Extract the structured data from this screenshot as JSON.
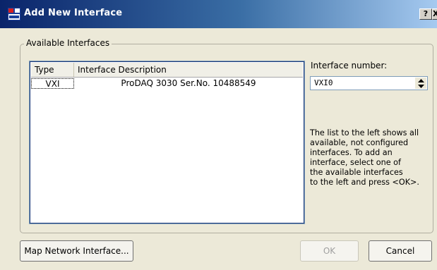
{
  "window": {
    "title": "Add New Interface",
    "icon_name": "app-logo-icon",
    "help_button_label": "?",
    "close_button_label": "X"
  },
  "group": {
    "label": "Available Interfaces"
  },
  "table": {
    "columns": [
      "Type",
      "Interface Description"
    ],
    "rows": [
      {
        "type": "VXI",
        "description": "ProDAQ 3030 Ser.No. 10488549"
      }
    ]
  },
  "interface_number": {
    "label": "Interface number:",
    "value": "VXI0"
  },
  "help_text": "The list to the left shows all\navailable, not configured\ninterfaces. To add an\ninterface, select one of\nthe available interfaces\nto the left and press <OK>.",
  "buttons": {
    "map_network": "Map Network Interface...",
    "ok": "OK",
    "cancel": "Cancel"
  },
  "colors": {
    "titlebar_start": "#0a246a",
    "titlebar_end": "#a6caf0",
    "dialog_bg": "#ece9d8"
  }
}
